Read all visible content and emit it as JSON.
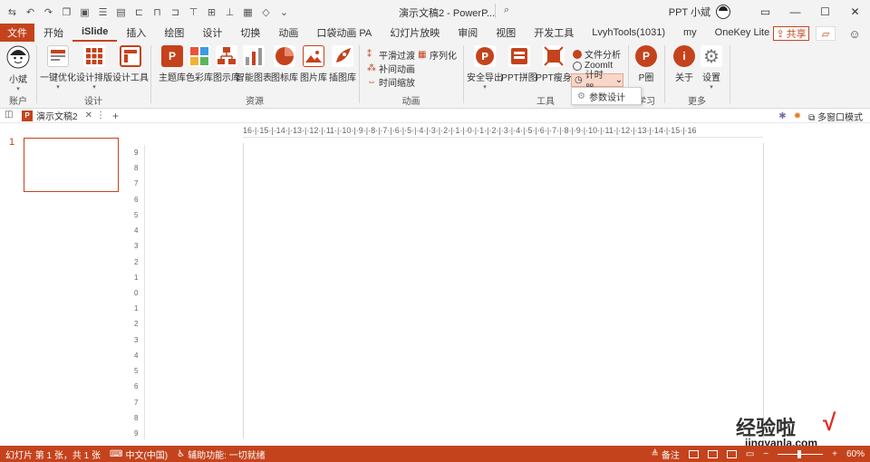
{
  "titlebar": {
    "document_title": "演示文稿2 - PowerP...",
    "search_icon": "search-icon",
    "user_name": "PPT 小斌"
  },
  "tabs": {
    "file": "文件",
    "items": [
      "开始",
      "iSlide",
      "插入",
      "绘图",
      "设计",
      "切换",
      "动画",
      "口袋动画 PA",
      "幻灯片放映",
      "审阅",
      "视图",
      "开发工具",
      "LvyhTools(1031)",
      "my",
      "OneKey Lite"
    ],
    "active": "iSlide",
    "share": "共享"
  },
  "ribbon": {
    "account": {
      "user_label": "小斌",
      "group_label": "账户"
    },
    "design": {
      "group_label": "设计",
      "buttons": [
        "一键优化",
        "设计排版",
        "设计工具"
      ]
    },
    "resources": {
      "group_label": "资源",
      "buttons": [
        "主题库",
        "色彩库",
        "图示库",
        "智能图表",
        "图标库",
        "图片库",
        "插图库"
      ]
    },
    "animation": {
      "group_label": "动画",
      "small_buttons": [
        "平滑过渡",
        "补间动画",
        "时间缩放",
        "序列化"
      ]
    },
    "tools": {
      "group_label": "工具",
      "buttons": [
        "安全导出",
        "PPT拼图",
        "PPT瘦身"
      ],
      "small_buttons": [
        "文件分析",
        "ZoomIt",
        "计时器"
      ],
      "dropdown_item": "参数设计"
    },
    "learn": {
      "group_label": "学习",
      "button": "P圈"
    },
    "more": {
      "group_label": "更多",
      "buttons": [
        "关于",
        "设置"
      ]
    }
  },
  "docbar": {
    "tab_label": "演示文稿2",
    "right_label": "多窗口模式"
  },
  "slides": {
    "current_number": "1"
  },
  "rulers": {
    "horizontal": "16·|·15·|·14·|·13·|·12·|·11·|·10·|·9·|·8·|·7·|·6·|·5·|·4·|·3·|·2·|·1·|·0·|·1·|·2·|·3·|·4·|·5·|·6·|·7·|·8·|·9·|·10·|·11·|·12·|·13·|·14·|·15·|·16",
    "vertical": [
      "9",
      "8",
      "7",
      "6",
      "5",
      "4",
      "3",
      "2",
      "1",
      "0",
      "1",
      "2",
      "3",
      "4",
      "5",
      "6",
      "7",
      "8",
      "9"
    ]
  },
  "statusbar": {
    "slide_info": "幻灯片 第 1 张，共 1 张",
    "language": "中文(中国)",
    "accessibility": "辅助功能: 一切就绪",
    "notes": "备注",
    "zoom": "60%"
  },
  "watermark": {
    "text_cn": "经验啦",
    "url": "jingyanla.com"
  },
  "colors": {
    "accent": "#c4431c",
    "ribbon_bg": "#f3f3f3"
  }
}
